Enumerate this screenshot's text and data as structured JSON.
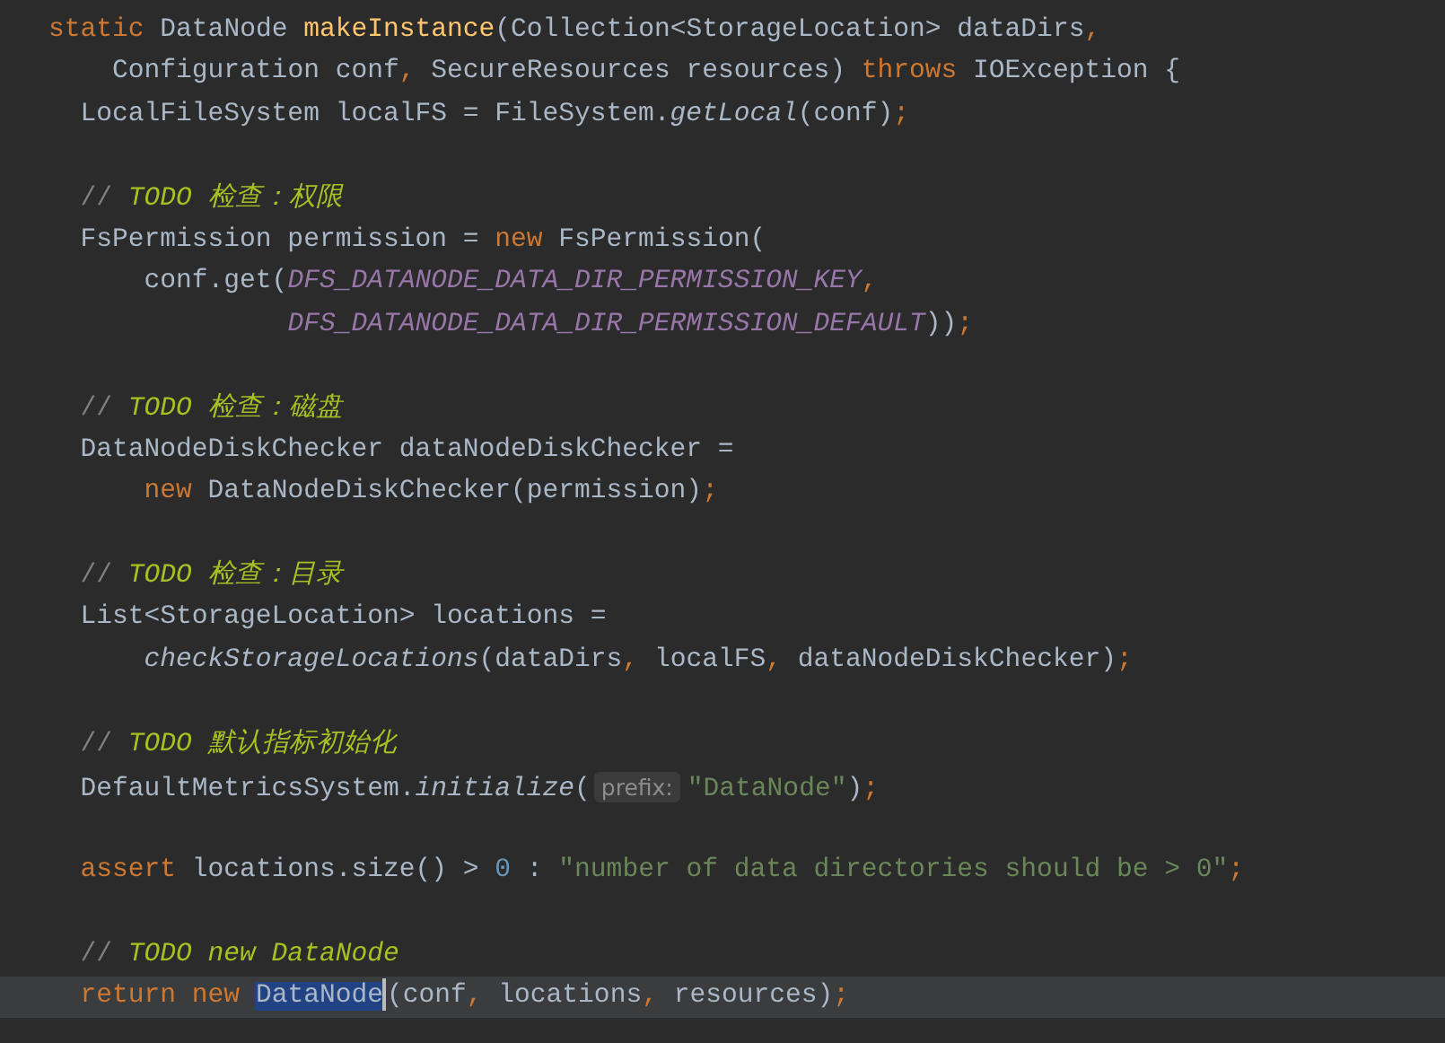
{
  "editor": {
    "lines": [
      {
        "kind": "signature",
        "current": false,
        "tokens": [
          {
            "kind": "keyword",
            "text": "static "
          },
          {
            "kind": "plain",
            "text": "DataNode "
          },
          {
            "kind": "method",
            "text": "makeInstance"
          },
          {
            "kind": "plain",
            "text": "(Collection<StorageLocation> dataDirs"
          },
          {
            "kind": "keyword",
            "text": ","
          }
        ]
      },
      {
        "kind": "wrap",
        "current": false,
        "tokens": [
          {
            "kind": "plain",
            "text": "Configuration conf"
          },
          {
            "kind": "keyword",
            "text": ", "
          },
          {
            "kind": "plain",
            "text": "SecureResources resources) "
          },
          {
            "kind": "keyword",
            "text": "throws "
          },
          {
            "kind": "plain",
            "text": "IOException {"
          }
        ]
      },
      {
        "kind": "statement",
        "current": false,
        "tokens": [
          {
            "kind": "plain",
            "text": "LocalFileSystem localFS = FileSystem."
          },
          {
            "kind": "call",
            "text": "getLocal"
          },
          {
            "kind": "plain",
            "text": "(conf)"
          },
          {
            "kind": "keyword",
            "text": ";"
          }
        ]
      },
      {
        "kind": "blank",
        "current": false
      },
      {
        "kind": "statement",
        "current": false,
        "tokens": [
          {
            "kind": "comment",
            "text": "// "
          },
          {
            "kind": "todo",
            "text": "TODO 检查：权限"
          }
        ]
      },
      {
        "kind": "statement",
        "current": false,
        "tokens": [
          {
            "kind": "plain",
            "text": "FsPermission permission = "
          },
          {
            "kind": "keyword",
            "text": "new "
          },
          {
            "kind": "plain",
            "text": "FsPermission("
          }
        ]
      },
      {
        "kind": "continuation",
        "current": false,
        "tokens": [
          {
            "kind": "plain",
            "text": "conf.get("
          },
          {
            "kind": "constant",
            "text": "DFS_DATANODE_DATA_DIR_PERMISSION_KEY"
          },
          {
            "kind": "keyword",
            "text": ","
          }
        ]
      },
      {
        "kind": "aligned",
        "current": false,
        "tokens": [
          {
            "kind": "constant",
            "text": "DFS_DATANODE_DATA_DIR_PERMISSION_DEFAULT"
          },
          {
            "kind": "plain",
            "text": "))"
          },
          {
            "kind": "keyword",
            "text": ";"
          }
        ]
      },
      {
        "kind": "blank",
        "current": false
      },
      {
        "kind": "statement",
        "current": false,
        "tokens": [
          {
            "kind": "comment",
            "text": "// "
          },
          {
            "kind": "todo",
            "text": "TODO 检查：磁盘"
          }
        ]
      },
      {
        "kind": "statement",
        "current": false,
        "tokens": [
          {
            "kind": "plain",
            "text": "DataNodeDiskChecker dataNodeDiskChecker ="
          }
        ]
      },
      {
        "kind": "continuation",
        "current": false,
        "tokens": [
          {
            "kind": "keyword",
            "text": "new "
          },
          {
            "kind": "plain",
            "text": "DataNodeDiskChecker(permission)"
          },
          {
            "kind": "keyword",
            "text": ";"
          }
        ]
      },
      {
        "kind": "blank",
        "current": false
      },
      {
        "kind": "statement",
        "current": false,
        "tokens": [
          {
            "kind": "comment",
            "text": "// "
          },
          {
            "kind": "todo",
            "text": "TODO 检查：目录"
          }
        ]
      },
      {
        "kind": "statement",
        "current": false,
        "tokens": [
          {
            "kind": "plain",
            "text": "List<StorageLocation> locations ="
          }
        ]
      },
      {
        "kind": "continuation",
        "current": false,
        "tokens": [
          {
            "kind": "call",
            "text": "checkStorageLocations"
          },
          {
            "kind": "plain",
            "text": "(dataDirs"
          },
          {
            "kind": "keyword",
            "text": ", "
          },
          {
            "kind": "plain",
            "text": "localFS"
          },
          {
            "kind": "keyword",
            "text": ", "
          },
          {
            "kind": "plain",
            "text": "dataNodeDiskChecker)"
          },
          {
            "kind": "keyword",
            "text": ";"
          }
        ]
      },
      {
        "kind": "blank",
        "current": false
      },
      {
        "kind": "statement",
        "current": false,
        "tokens": [
          {
            "kind": "comment",
            "text": "// "
          },
          {
            "kind": "todo",
            "text": "TODO 默认指标初始化"
          }
        ]
      },
      {
        "kind": "statement",
        "current": false,
        "tokens": [
          {
            "kind": "plain",
            "text": "DefaultMetricsSystem."
          },
          {
            "kind": "call",
            "text": "initialize"
          },
          {
            "kind": "plain",
            "text": "("
          },
          {
            "kind": "hint",
            "text": "prefix:"
          },
          {
            "kind": "string",
            "text": "\"DataNode\""
          },
          {
            "kind": "plain",
            "text": ")"
          },
          {
            "kind": "keyword",
            "text": ";"
          }
        ]
      },
      {
        "kind": "blank",
        "current": false
      },
      {
        "kind": "statement",
        "current": false,
        "tokens": [
          {
            "kind": "keyword",
            "text": "assert "
          },
          {
            "kind": "plain",
            "text": "locations.size() > "
          },
          {
            "kind": "number",
            "text": "0 "
          },
          {
            "kind": "plain",
            "text": ": "
          },
          {
            "kind": "string",
            "text": "\"number of data directories should be > 0\""
          },
          {
            "kind": "keyword",
            "text": ";"
          }
        ]
      },
      {
        "kind": "blank",
        "current": false
      },
      {
        "kind": "statement",
        "current": false,
        "tokens": [
          {
            "kind": "comment",
            "text": "// "
          },
          {
            "kind": "todo",
            "text": "TODO new DataNode"
          }
        ]
      },
      {
        "kind": "statement",
        "current": true,
        "tokens": [
          {
            "kind": "keyword",
            "text": "return new "
          },
          {
            "kind": "selection",
            "text": "DataNode"
          },
          {
            "kind": "plain",
            "text": "(conf"
          },
          {
            "kind": "keyword",
            "text": ", "
          },
          {
            "kind": "plain",
            "text": "locations"
          },
          {
            "kind": "keyword",
            "text": ", "
          },
          {
            "kind": "plain",
            "text": "resources)"
          },
          {
            "kind": "keyword",
            "text": ";"
          }
        ]
      }
    ]
  }
}
